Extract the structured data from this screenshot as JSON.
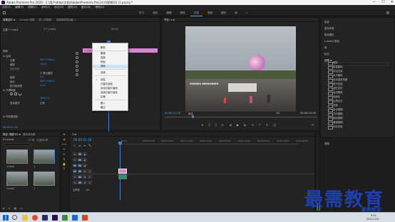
{
  "window": {
    "title": "Adobe Premiere Pro 2020 - C:\\用户\\ddoz\\文档\\Adobe\\Premiere Pro\\14.0\\视频\\01 \\1.prproj *",
    "controls": [
      "—",
      "☐",
      "✕"
    ]
  },
  "menubar": [
    "文件(F)",
    "编辑(E)",
    "剪辑(C)",
    "序列(S)",
    "标记(M)",
    "图形(G)",
    "窗口(W)",
    "帮助(H)"
  ],
  "workspaces": [
    "学习",
    "组件",
    "编辑",
    "颜色",
    "效果",
    "音频",
    "图形",
    "库",
    "»"
  ],
  "active_workspace": "效果",
  "effect_controls": {
    "tabs": [
      "效果控件 ≡",
      "Lumetri 范围",
      "源: (无剪辑)",
      "音频剪辑混合器: 1"
    ],
    "master": "主要 * 1.mp4",
    "sequence": "1 * 1.mp4",
    "clip_label": "1.mp4",
    "timecode_right": "00:00",
    "video_header": "视频",
    "section_motion": "fx 运动",
    "rows": [
      {
        "label": "位置",
        "value": "960.0   540.0"
      },
      {
        "label": "缩放",
        "value": "100.0"
      },
      {
        "label": "缩放宽度",
        "value": ""
      },
      {
        "label": "",
        "value": "☑ 等比缩放"
      },
      {
        "label": "旋转",
        "value": "0.0"
      },
      {
        "label": "锚点",
        "value": "960.0   540.0"
      },
      {
        "label": "防闪烁滤镜",
        "value": "0.00"
      }
    ],
    "section_opacity": "fx 不透明度",
    "opacity_value": "100.0 %",
    "blend_mode_label": "混合模式",
    "blend_mode_value": "正常",
    "section_time": "fx 时间重映射",
    "time_remap_value": "正常",
    "footer_timecode": "00:00:01:18"
  },
  "context_menu": {
    "items": [
      {
        "label": "删除",
        "highlight": false
      },
      {
        "label": "撤销",
        "highlight": false
      },
      {
        "label": "复制",
        "highlight": false
      },
      {
        "label": "粘贴",
        "highlight": false
      },
      {
        "label": "清除",
        "highlight": true
      },
      {
        "label": "选择",
        "highlight": false
      },
      {
        "label": "线性",
        "highlight": false
      },
      {
        "label": "贝塞尔曲线",
        "highlight": false
      },
      {
        "label": "自动贝塞尔曲线",
        "highlight": false
      },
      {
        "label": "连续贝塞尔曲线",
        "highlight": false
      },
      {
        "label": "定格",
        "highlight": false
      },
      {
        "label": "缓入",
        "highlight": false
      },
      {
        "label": "缓出",
        "highlight": false
      }
    ]
  },
  "program_monitor": {
    "tab": "节目: 1 ≡",
    "overlay_text": "SHOWS MEMORIES",
    "timecode_current": "00:00:01:18",
    "fit": "适合",
    "ratio": "1/2",
    "timecode_total": "00:00:10:00"
  },
  "project_panel": {
    "tabs": [
      "项目: 视频 01 ≡",
      "媒体浏览器",
      "库",
      "信息"
    ],
    "project_name": "01.prproj",
    "count": "1个项，已选择1项",
    "items": [
      "1.mp4",
      "1",
      "1.mp4",
      "1"
    ]
  },
  "timeline": {
    "tab": "1 ≡",
    "timecode": "00:00:01:18",
    "ruler": [
      "00:00",
      "00:00:05:00",
      "00:00:10:00",
      "00:00:15:00",
      "00:00:20:00",
      "00:00:25:00",
      "00:00:30:00",
      "00:00:35:00",
      "00:00:40:00",
      "00:00:45:00"
    ],
    "tracks": [
      {
        "name": "V3",
        "type": "v"
      },
      {
        "name": "V2",
        "type": "v"
      },
      {
        "name": "V1",
        "type": "v"
      },
      {
        "name": "A1",
        "type": "a"
      },
      {
        "name": "A2",
        "type": "a"
      },
      {
        "name": "A3",
        "type": "a"
      }
    ],
    "master": "主声道",
    "master_value": "0.0"
  },
  "right_panel": {
    "top_items": [
      "信息",
      "基本声音",
      "基本图形",
      "Lumetri 颜色",
      "库",
      "标记"
    ],
    "effects_header": "效果 ≡",
    "effect_items": [
      "裁剪",
      "垂直翻转",
      "羽化边缘",
      "水平翻转",
      "自动重新构图",
      "镜头扭曲",
      "波形变形",
      "湍流置换",
      "球面化",
      "边角定位",
      "变换",
      "复合模糊",
      "方向模糊",
      "相机模糊",
      "通道模糊",
      "钝化蒙版"
    ],
    "audio_label": "音频"
  },
  "taskbar": {
    "search_icon": "search-icon",
    "time": "9:51",
    "date": "2021/7/14"
  },
  "watermark": {
    "main": "最需教育",
    "small": "最需教育"
  }
}
